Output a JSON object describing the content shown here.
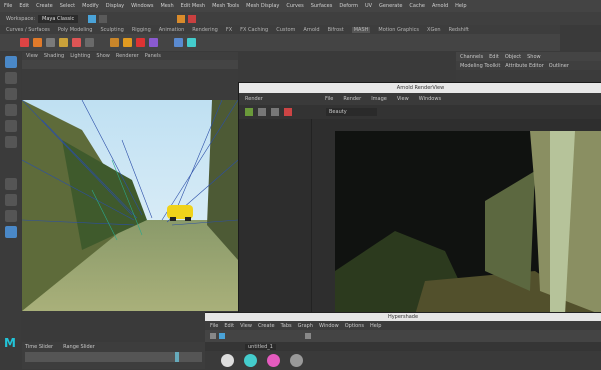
{
  "menubar": {
    "items": [
      "File",
      "Edit",
      "Create",
      "Select",
      "Modify",
      "Display",
      "Windows",
      "Mesh",
      "Edit Mesh",
      "Mesh Tools",
      "Mesh Display",
      "Curves",
      "Surfaces",
      "Deform",
      "UV",
      "Generate",
      "Cache",
      "Arnold",
      "Help"
    ],
    "workspace_label": "Workspace:",
    "workspace_value": "Maya Classic"
  },
  "shelf": {
    "tabs": [
      "Curves / Surfaces",
      "Poly Modeling",
      "Sculpting",
      "Rigging",
      "Animation",
      "Rendering",
      "FX",
      "FX Caching",
      "Custom",
      "Arnold",
      "Bifrost",
      "MASH",
      "Motion Graphics",
      "XGen",
      "Redshift"
    ]
  },
  "viewport": {
    "menu": [
      "View",
      "Shading",
      "Lighting",
      "Show",
      "Renderer",
      "Panels"
    ],
    "axis_label": "Y"
  },
  "channel_box": {
    "tabs": [
      "Channels",
      "Edit",
      "Object",
      "Show"
    ],
    "side_tabs": [
      "Modeling Toolkit",
      "Attribute Editor",
      "Outliner"
    ]
  },
  "render_view": {
    "title": "Arnold RenderView",
    "menu": [
      "File",
      "Render",
      "Image",
      "View",
      "Windows"
    ],
    "left_header": "Render",
    "dropdown": "Beauty"
  },
  "hypershade": {
    "title": "Hypershade",
    "menu": [
      "File",
      "Edit",
      "View",
      "Create",
      "Tabs",
      "Graph",
      "Window",
      "Options",
      "Help"
    ],
    "tab_label": "untitled_1"
  },
  "timeline": {
    "labels": [
      "Time Slider",
      "Range Slider"
    ]
  }
}
